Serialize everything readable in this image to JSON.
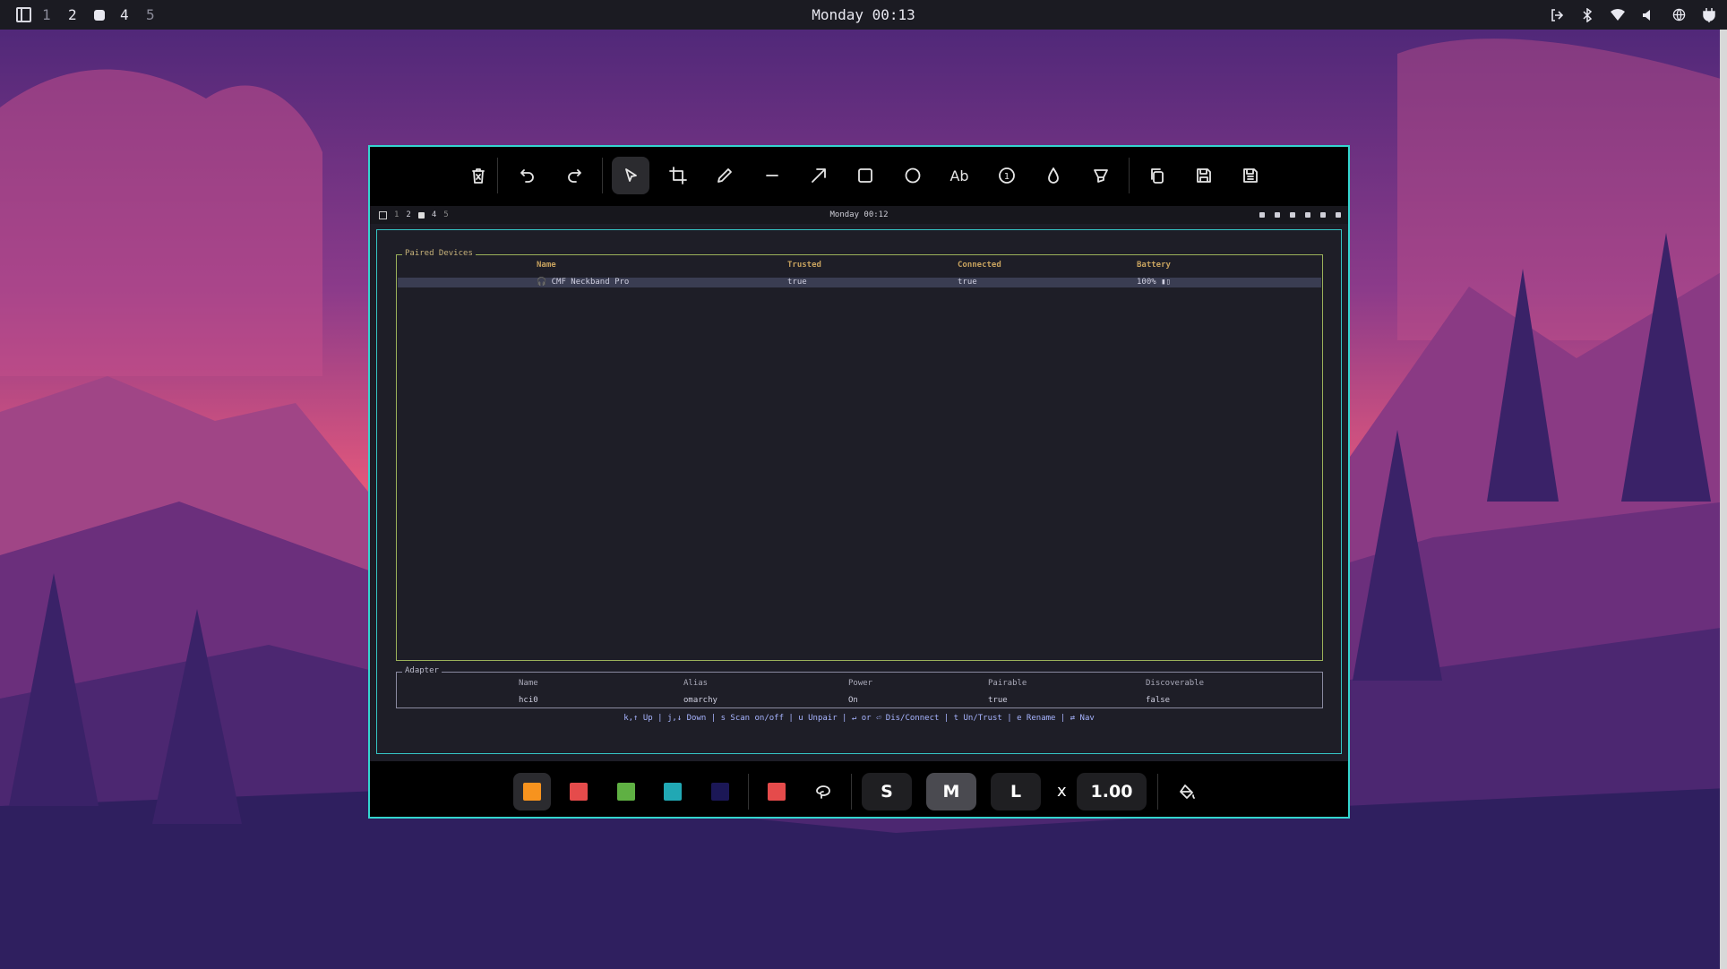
{
  "topbar": {
    "workspaces": [
      "1",
      "2",
      "4",
      "5"
    ],
    "clock": "Monday 00:13",
    "tray_icons": [
      "logout-icon",
      "bluetooth-icon",
      "wifi-icon",
      "volume-icon",
      "globe-icon",
      "battery-plug-icon"
    ]
  },
  "editor": {
    "toolbar_icons": [
      "trash-icon",
      "undo-icon",
      "redo-icon",
      "pointer-icon",
      "crop-icon",
      "pencil-icon",
      "line-icon",
      "arrow-icon",
      "rectangle-icon",
      "ellipse-icon",
      "text-icon",
      "marker-icon",
      "blur-icon",
      "highlighter-icon",
      "copy-icon",
      "save-icon",
      "save-as-icon"
    ],
    "text_tool_label": "Ab",
    "marker_label": "1",
    "active_tool": "pointer",
    "colors": [
      "#f7931e",
      "#e54b4b",
      "#5fb043",
      "#21a8b4",
      "#1b1756",
      "#e54b4b"
    ],
    "selected_color": "#f7931e",
    "sizes": [
      "S",
      "M",
      "L"
    ],
    "selected_size": "M",
    "multiplier": "x",
    "scale": "1.00"
  },
  "screenshot": {
    "mini_topbar": {
      "workspaces": [
        "1",
        "2",
        "4",
        "5"
      ],
      "clock": "Monday 00:12"
    },
    "devices_panel": {
      "title": "Paired Devices",
      "headers": [
        "Name",
        "Trusted",
        "Connected",
        "Battery"
      ],
      "rows": [
        {
          "name": "🎧 CMF Neckband Pro",
          "trusted": "true",
          "connected": "true",
          "battery": "100% ▮▯"
        }
      ]
    },
    "adapter_panel": {
      "title": "Adapter",
      "headers": [
        "Name",
        "Alias",
        "Power",
        "Pairable",
        "Discoverable"
      ],
      "values": [
        "hci0",
        "omarchy",
        "On",
        "true",
        "false"
      ]
    },
    "help_line": "k,↑ Up | j,↓ Down | s Scan on/off | u Unpair | ↵ or ⏎ Dis/Connect | t Un/Trust | e Rename | ⇄ Nav"
  }
}
